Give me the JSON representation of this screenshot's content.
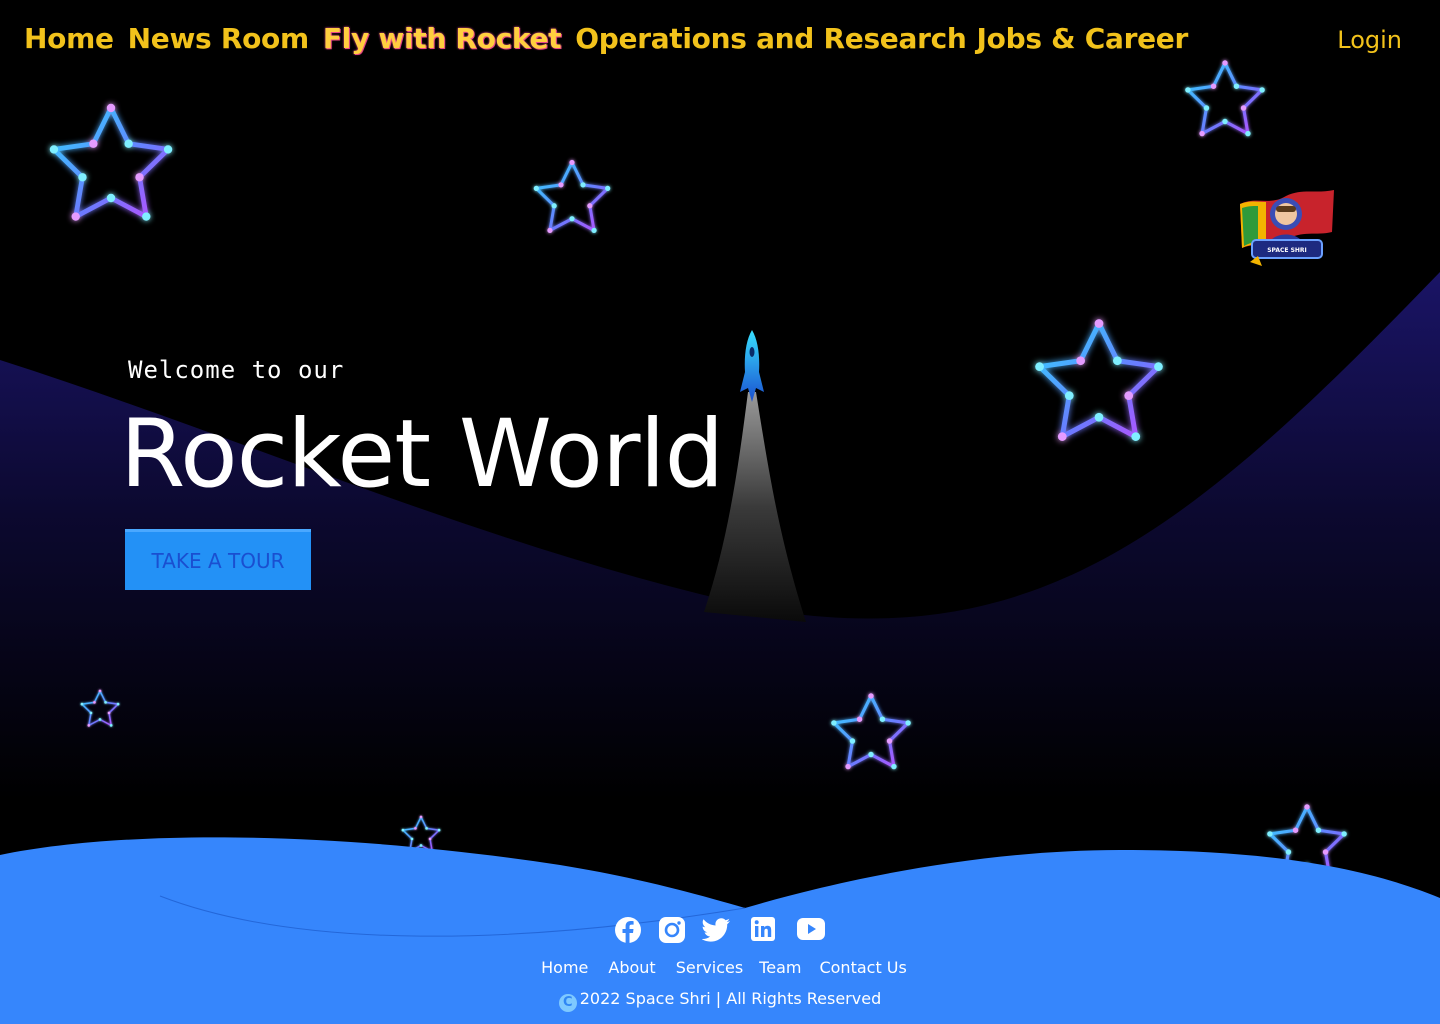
{
  "nav": {
    "items": [
      {
        "label": "Home",
        "active": false
      },
      {
        "label": "News Room",
        "active": false
      },
      {
        "label": "Fly with Rocket",
        "active": true
      },
      {
        "label": "Operations and Research",
        "active": false
      },
      {
        "label": "Jobs & Career",
        "active": false
      }
    ],
    "login_label": "Login"
  },
  "hero": {
    "welcome": "Welcome to our",
    "title": "Rocket World",
    "cta_label": "TAKE A TOUR"
  },
  "badge": {
    "text": "SPACE SHRI"
  },
  "footer": {
    "social": [
      "facebook-icon",
      "instagram-icon",
      "twitter-icon",
      "linkedin-icon",
      "youtube-icon"
    ],
    "links": [
      "Home",
      "About",
      "Services",
      "Team",
      "Contact Us"
    ],
    "copyright": "2022 Space Shri | All Rights Reserved",
    "copyright_symbol": "C"
  },
  "colors": {
    "nav_text": "#f2c21b",
    "background": "#000000",
    "hill": "#16115a",
    "footer_bg": "#3686fc",
    "button_bg": "#2391f6",
    "button_text": "#1a4fd0"
  }
}
